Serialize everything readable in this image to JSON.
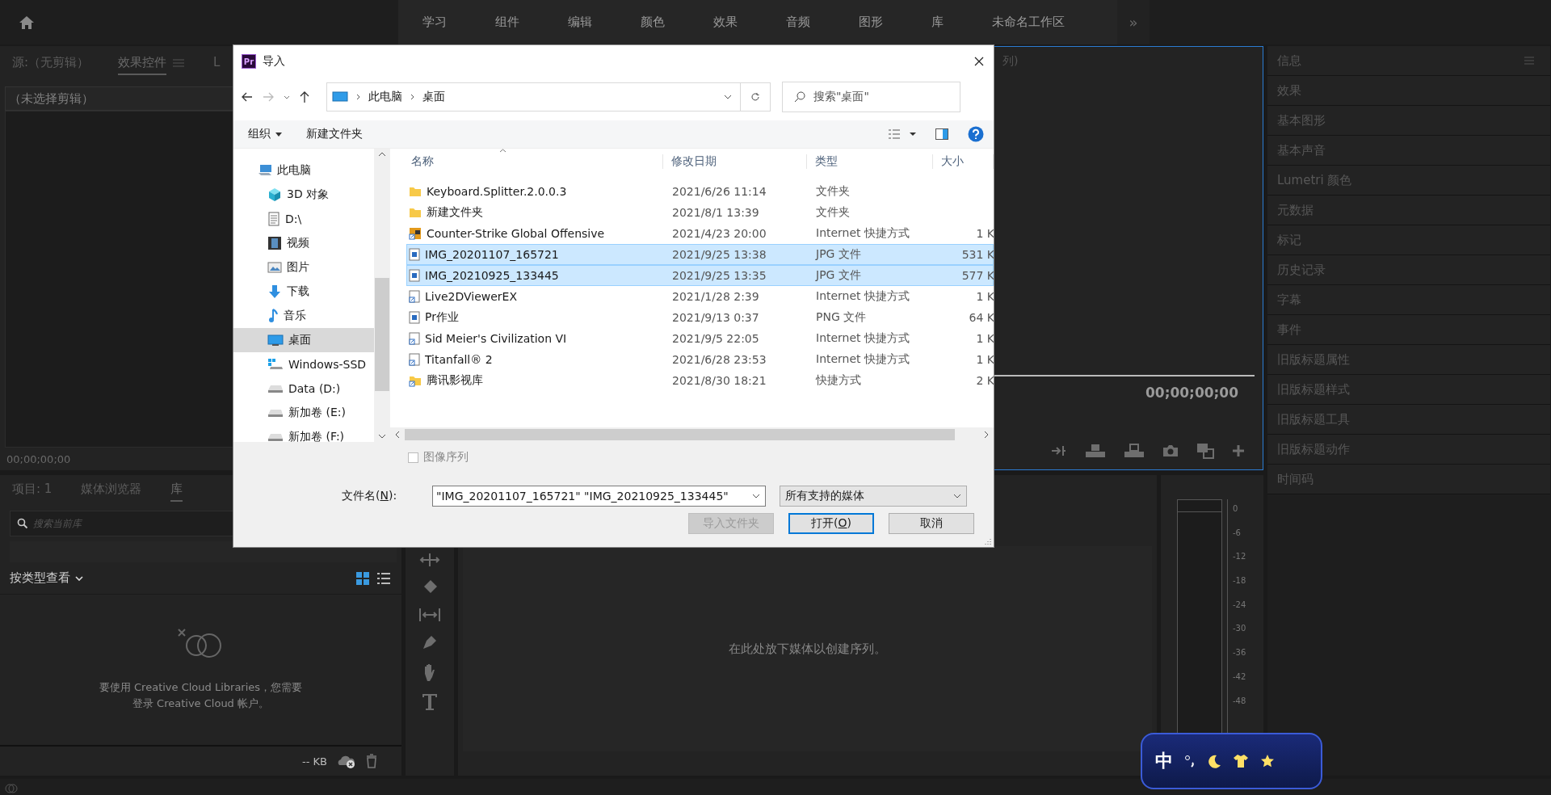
{
  "workspace_bar": {
    "tabs": [
      "学习",
      "组件",
      "编辑",
      "颜色",
      "效果",
      "音频",
      "图形",
      "库",
      "未命名工作区"
    ],
    "overflow": "»"
  },
  "source_panel": {
    "tabs": [
      {
        "label": "源:（无剪辑）",
        "selected": false
      },
      {
        "label": "效果控件",
        "selected": true
      },
      {
        "label": "L",
        "selected": false
      }
    ],
    "clip_label": "（未选择剪辑）",
    "timecode": "00;00;00;00"
  },
  "program_monitor": {
    "title": "列)",
    "timecode": "00;00;00;00"
  },
  "side_panels": {
    "items": [
      "信息",
      "效果",
      "基本图形",
      "基本声音",
      "Lumetri 颜色",
      "元数据",
      "标记",
      "历史记录",
      "字幕",
      "事件",
      "旧版标题属性",
      "旧版标题样式",
      "旧版标题工具",
      "旧版标题动作",
      "时间码"
    ]
  },
  "project_panel": {
    "tabs": [
      {
        "label": "项目: 1",
        "selected": false
      },
      {
        "label": "媒体浏览器",
        "selected": false
      },
      {
        "label": "库",
        "selected": true
      }
    ],
    "search": {
      "placeholder": "搜索当前库"
    },
    "view_filter": "按类型查看",
    "message_lines": [
      "要使用 Creative Cloud Libraries，您需要",
      "登录 Creative Cloud 帐户。"
    ],
    "storage": "-- KB"
  },
  "timeline": {
    "empty_hint": "在此处放下媒体以创建序列。"
  },
  "audio_meter": {
    "scale": [
      "0",
      "-6",
      "-12",
      "-18",
      "-24",
      "-30",
      "-36",
      "-42",
      "-48"
    ]
  },
  "import_dialog": {
    "app_icon_text": "Pr",
    "title": "导入",
    "breadcrumb": [
      "此电脑",
      "桌面"
    ],
    "search": {
      "placeholder": "搜索\"桌面\""
    },
    "commands": {
      "organize": "组织",
      "new_folder": "新建文件夹"
    },
    "nav": [
      {
        "label": "此电脑",
        "kind": "pc",
        "selected": false,
        "children": [
          {
            "label": "3D 对象",
            "kind": "cube",
            "selected": false
          },
          {
            "label": "D:\\",
            "kind": "document",
            "selected": false
          },
          {
            "label": "视频",
            "kind": "film",
            "selected": false
          },
          {
            "label": "图片",
            "kind": "image",
            "selected": false
          },
          {
            "label": "下载",
            "kind": "download",
            "selected": false
          },
          {
            "label": "音乐",
            "kind": "music",
            "selected": false
          },
          {
            "label": "桌面",
            "kind": "desktop",
            "selected": true
          },
          {
            "label": "Windows-SSD",
            "kind": "windows-drive",
            "selected": false
          },
          {
            "label": "Data (D:)",
            "kind": "drive",
            "selected": false
          },
          {
            "label": "新加卷 (E:)",
            "kind": "drive",
            "selected": false
          },
          {
            "label": "新加卷 (F:)",
            "kind": "drive",
            "selected": false
          }
        ]
      }
    ],
    "columns": [
      "名称",
      "修改日期",
      "类型",
      "大小"
    ],
    "files": [
      {
        "name": "Keyboard.Splitter.2.0.0.3",
        "date": "2021/6/26 11:14",
        "type": "文件夹",
        "kind": "folder",
        "selected": false
      },
      {
        "name": "新建文件夹",
        "date": "2021/8/1 13:39",
        "type": "文件夹",
        "kind": "folder",
        "selected": false
      },
      {
        "name": "Counter-Strike Global Offensive",
        "date": "2021/4/23 20:00",
        "type": "Internet 快捷方式",
        "size": "1 K",
        "kind": "app-shortcut",
        "selected": false
      },
      {
        "name": "IMG_20201107_165721",
        "date": "2021/9/25 13:38",
        "type": "JPG 文件",
        "size": "531 K",
        "kind": "image",
        "selected": true
      },
      {
        "name": "IMG_20210925_133445",
        "date": "2021/9/25 13:35",
        "type": "JPG 文件",
        "size": "577 K",
        "kind": "image",
        "selected": true
      },
      {
        "name": "Live2DViewerEX",
        "date": "2021/1/28 2:39",
        "type": "Internet 快捷方式",
        "size": "1 K",
        "kind": "shortcut",
        "selected": false
      },
      {
        "name": "Pr作业",
        "date": "2021/9/13 0:37",
        "type": "PNG 文件",
        "size": "64 K",
        "kind": "image",
        "selected": false
      },
      {
        "name": "Sid Meier's Civilization VI",
        "date": "2021/9/5 22:05",
        "type": "Internet 快捷方式",
        "size": "1 K",
        "kind": "shortcut",
        "selected": false
      },
      {
        "name": "Titanfall® 2",
        "date": "2021/6/28 23:53",
        "type": "Internet 快捷方式",
        "size": "1 K",
        "kind": "shortcut",
        "selected": false
      },
      {
        "name": "腾讯影视库",
        "date": "2021/8/30 18:21",
        "type": "快捷方式",
        "size": "2 K",
        "kind": "folder-shortcut",
        "selected": false
      }
    ],
    "image_sequence": {
      "label": "图像序列",
      "checked": false,
      "disabled": true
    },
    "filename": {
      "label_before": "文件名(",
      "access_key": "N",
      "label_after": "):",
      "value": "\"IMG_20201107_165721\" \"IMG_20210925_133445\""
    },
    "filter": "所有支持的媒体",
    "buttons": [
      {
        "label": "导入文件夹",
        "kind": "normal",
        "disabled": true
      },
      {
        "label_before": "打开(",
        "access_key": "O",
        "label_after": ")",
        "kind": "default",
        "disabled": false
      },
      {
        "label": "取消",
        "kind": "normal",
        "disabled": false
      }
    ]
  },
  "ime_bar": {
    "mode": "中"
  }
}
